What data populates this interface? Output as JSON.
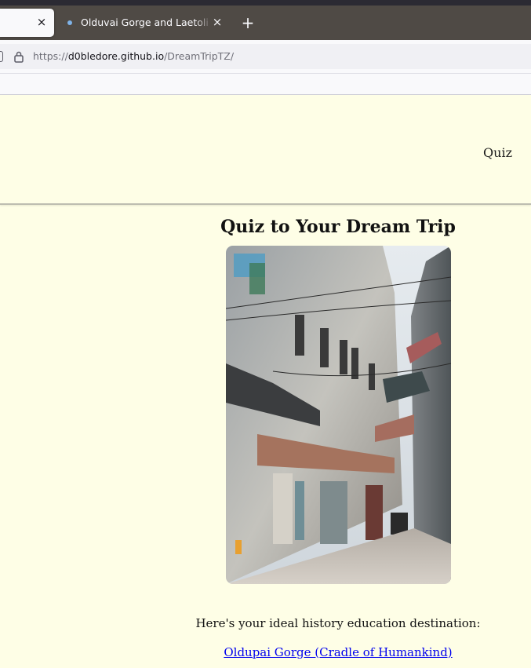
{
  "browser": {
    "tabs": [
      {
        "title": "",
        "active": true
      },
      {
        "title": "Olduvai Gorge and Laetoli Tanzania",
        "active": false
      }
    ],
    "close_glyph": "×",
    "new_tab_glyph": "+",
    "url": {
      "scheme": "https://",
      "host": "d0bledore.github.io",
      "path": "/DreamTripTZ/"
    },
    "icons": [
      "lock-icon",
      "close-icon",
      "new-tab-icon",
      "tracking-protection-icon"
    ]
  },
  "site": {
    "nav": {
      "quiz_label": "Quiz"
    },
    "title": "Quiz to Your Dream Trip",
    "result_text": "Here's your ideal history education destination:",
    "result_link": "Oldupai Gorge (Cradle of Humankind)"
  },
  "colors": {
    "page_background": "#fefee6",
    "tab_bar": "#4f4a45",
    "link": "#0000ee"
  }
}
